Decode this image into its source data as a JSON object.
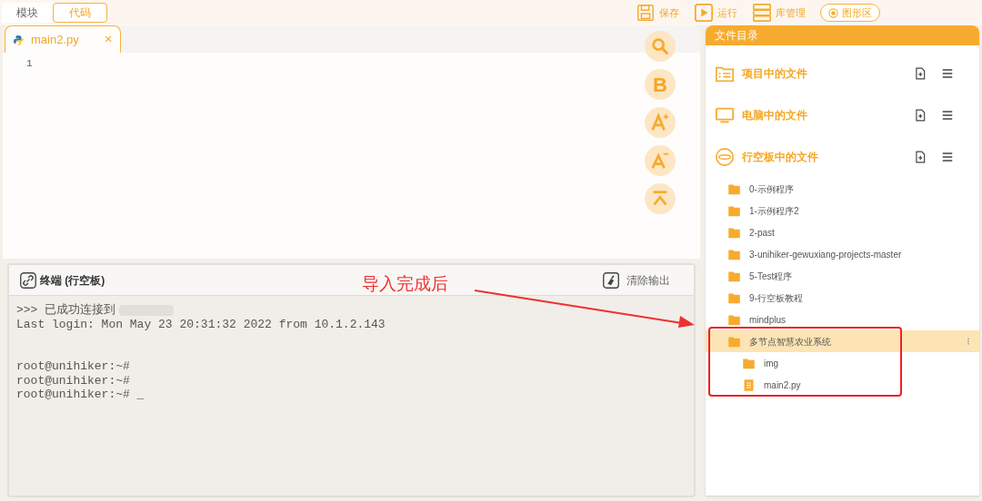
{
  "mode_tabs": [
    {
      "label": "模块",
      "selected": false
    },
    {
      "label": "代码",
      "selected": true
    }
  ],
  "toolbar": [
    {
      "kind": "save",
      "label": "保存"
    },
    {
      "kind": "run",
      "label": "运行"
    },
    {
      "kind": "library",
      "label": "库管理"
    },
    {
      "kind": "graphic",
      "label": "图形区"
    }
  ],
  "editor": {
    "tab": {
      "label": "main2.py",
      "close": "×"
    },
    "line_numbers": [
      "1"
    ],
    "side_buttons": [
      {
        "kind": "search"
      },
      {
        "kind": "bold",
        "label": "B"
      },
      {
        "kind": "font_up"
      },
      {
        "kind": "font_down"
      },
      {
        "kind": "top"
      }
    ]
  },
  "terminal": {
    "title": "终端 (行空板)",
    "clear": "清除输出",
    "lines": [
      {
        "kind": "connect",
        "text": ">>> 已成功连接到"
      },
      {
        "kind": "text",
        "text": "Last login: Mon May 23 20:31:32 2022 from 10.1.2.143"
      },
      {
        "kind": "blank"
      },
      {
        "kind": "blank"
      },
      {
        "kind": "text",
        "text": "root@unihiker:~#"
      },
      {
        "kind": "text",
        "text": "root@unihiker:~#"
      },
      {
        "kind": "cursor",
        "text": "root@unihiker:~# _"
      }
    ]
  },
  "annotation": {
    "text": "导入完成后"
  },
  "file_panel": {
    "title": "文件目录",
    "sections": [
      {
        "kind": "project",
        "label": "项目中的文件"
      },
      {
        "kind": "computer",
        "label": "电脑中的文件"
      },
      {
        "kind": "board",
        "label": "行空板中的文件"
      }
    ],
    "tree": [
      {
        "kind": "folder",
        "label": "0-示例程序",
        "selected": false
      },
      {
        "kind": "folder",
        "label": "1-示例程序2",
        "selected": false
      },
      {
        "kind": "folder",
        "label": "2-past",
        "selected": false
      },
      {
        "kind": "folder",
        "label": "3-unihiker-gewuxiang-projects-master",
        "selected": false
      },
      {
        "kind": "folder",
        "label": "5-Test程序",
        "selected": false
      },
      {
        "kind": "folder",
        "label": "9-行空板教程",
        "selected": false
      },
      {
        "kind": "folder",
        "label": "mindplus",
        "selected": false
      },
      {
        "kind": "folder",
        "label": "多节点智慧农业系统",
        "selected": true,
        "children": [
          {
            "kind": "folder",
            "label": "img",
            "selected": false
          },
          {
            "kind": "file",
            "label": "main2.py",
            "selected": false
          }
        ]
      }
    ]
  }
}
